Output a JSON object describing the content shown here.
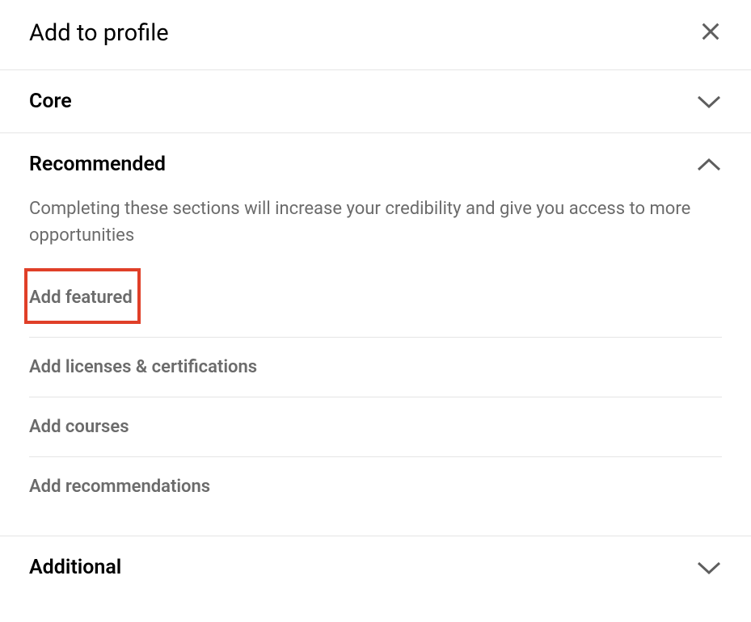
{
  "header": {
    "title": "Add to profile"
  },
  "sections": {
    "core": {
      "title": "Core"
    },
    "recommended": {
      "title": "Recommended",
      "description": "Completing these sections will increase your credibility and give you access to more opportunities",
      "items": [
        {
          "label": "Add featured"
        },
        {
          "label": "Add licenses & certifications"
        },
        {
          "label": "Add courses"
        },
        {
          "label": "Add recommendations"
        }
      ]
    },
    "additional": {
      "title": "Additional"
    }
  }
}
